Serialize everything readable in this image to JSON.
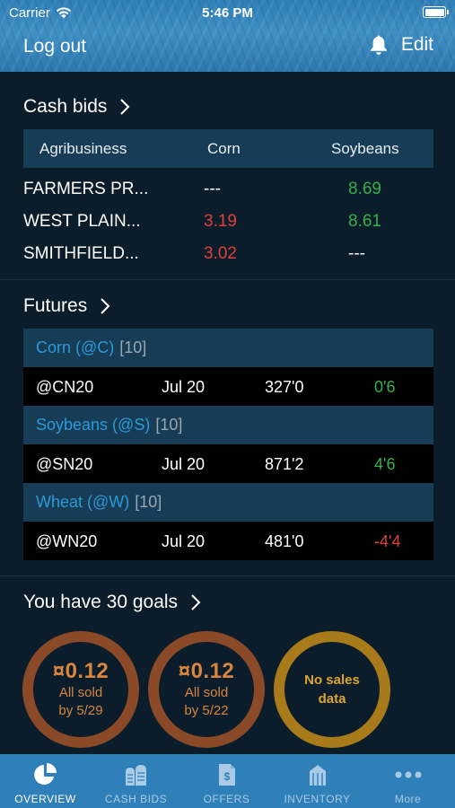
{
  "status_bar": {
    "carrier": "Carrier",
    "time": "5:46 PM"
  },
  "nav": {
    "logout": "Log out",
    "edit": "Edit"
  },
  "cash_bids": {
    "title": "Cash bids",
    "columns": [
      "Agribusiness",
      "Corn",
      "Soybeans"
    ],
    "rows": [
      {
        "name": "FARMERS PR...",
        "corn": "---",
        "soybeans": "8.69"
      },
      {
        "name": "WEST PLAIN...",
        "corn": "3.19",
        "soybeans": "8.61"
      },
      {
        "name": "SMITHFIELD...",
        "corn": "3.02",
        "soybeans": "---"
      }
    ]
  },
  "futures": {
    "title": "Futures",
    "groups": [
      {
        "name": "Corn (@C)",
        "count": "[10]",
        "row": {
          "symbol": "@CN20",
          "month": "Jul 20",
          "price": "327'0",
          "change": "0'6"
        }
      },
      {
        "name": "Soybeans (@S)",
        "count": "[10]",
        "row": {
          "symbol": "@SN20",
          "month": "Jul 20",
          "price": "871'2",
          "change": "4'6"
        }
      },
      {
        "name": "Wheat (@W)",
        "count": "[10]",
        "row": {
          "symbol": "@WN20",
          "month": "Jul 20",
          "price": "481'0",
          "change": "-4'4"
        }
      }
    ]
  },
  "goals": {
    "title": "You have 30 goals",
    "items": [
      {
        "value": "¤0.12",
        "line1": "All sold",
        "line2": "by 5/29"
      },
      {
        "value": "¤0.12",
        "line1": "All sold",
        "line2": "by 5/22"
      },
      {
        "line1": "No sales",
        "line2": "data"
      }
    ]
  },
  "tabs": [
    {
      "label": "OVERVIEW",
      "icon": "pie-chart-icon"
    },
    {
      "label": "CASH BIDS",
      "icon": "grain-silo-icon"
    },
    {
      "label": "OFFERS",
      "icon": "document-dollar-icon"
    },
    {
      "label": "INVENTORY",
      "icon": "grain-bin-icon"
    },
    {
      "label": "More",
      "icon": "more-dots-icon"
    }
  ],
  "colors": {
    "header_blue": "#2f7fb8",
    "background": "#0b1d2a",
    "table_header": "#173c56",
    "positive": "#33b04a",
    "negative": "#e0403a",
    "futures_group": "#2b9ad8",
    "goal_brown": "#8a4a27",
    "goal_gold": "#a87a1a"
  }
}
